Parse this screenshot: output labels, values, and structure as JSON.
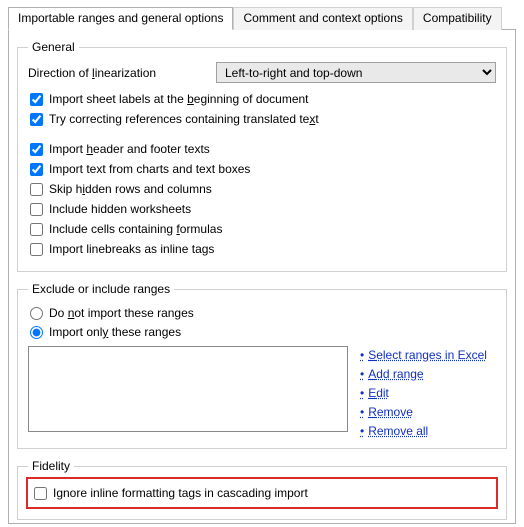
{
  "tabs": {
    "t0": "Importable ranges and general options",
    "t1": "Comment and context options",
    "t2": "Compatibility"
  },
  "general": {
    "legend": "General",
    "direction_label_pre": "Direction of ",
    "direction_label_accel": "l",
    "direction_label_post": "inearization",
    "direction_value": "Left-to-right and top-down",
    "cb_sheet_pre": "Import sheet labels at the ",
    "cb_sheet_accel": "b",
    "cb_sheet_post": "eginning of document",
    "cb_refs_pre": "Try correcting references containing translated te",
    "cb_refs_accel": "x",
    "cb_refs_post": "t",
    "cb_header_pre": "Import ",
    "cb_header_accel": "h",
    "cb_header_post": "eader and footer texts",
    "cb_charts": "Import text from charts and text boxes",
    "cb_hidden_rows_pre": "Skip h",
    "cb_hidden_rows_accel": "i",
    "cb_hidden_rows_post": "dden rows and columns",
    "cb_hidden_ws": "Include hidden worksheets",
    "cb_formulas_pre": "Include cells containing ",
    "cb_formulas_accel": "f",
    "cb_formulas_post": "ormulas",
    "cb_linebreaks": "Import linebreaks as inline tags"
  },
  "exclude": {
    "legend": "Exclude or include ranges",
    "radio_not_pre": "Do ",
    "radio_not_accel": "n",
    "radio_not_post": "ot import these ranges",
    "radio_only_pre": "Import onl",
    "radio_only_accel": "y",
    "radio_only_post": " these ranges",
    "ranges_value": "",
    "link_select_accel": "S",
    "link_select_post": "elect ranges in Excel",
    "link_add_accel": "A",
    "link_add_post": "dd range",
    "link_edit_accel": "E",
    "link_edit_post": "dit",
    "link_remove_accel": "R",
    "link_remove_post": "emove",
    "link_removeall": "Remove all"
  },
  "fidelity": {
    "legend": "Fidelity",
    "cb_ignore": "Ignore inline formatting tags in cascading import"
  }
}
